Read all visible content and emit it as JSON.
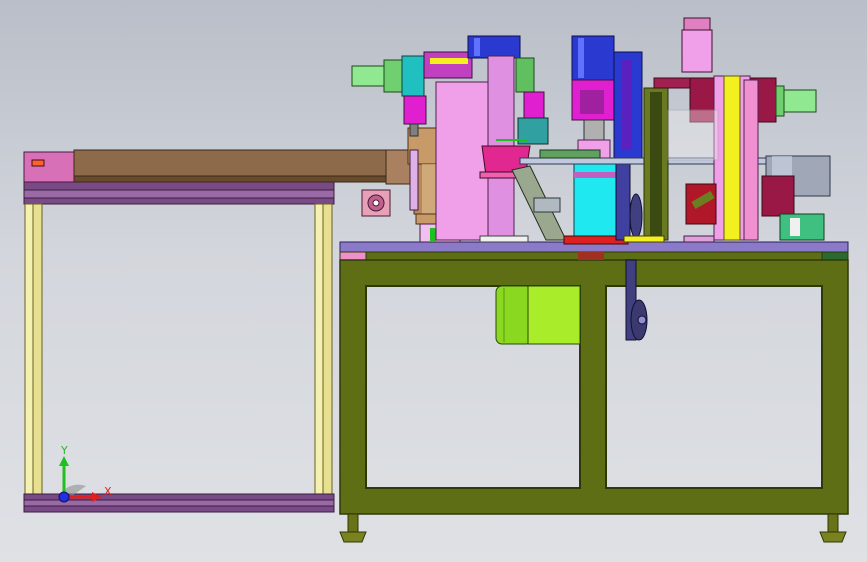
{
  "viewport": {
    "background_top": "#b9bec8",
    "background_bottom": "#dfe1e5"
  },
  "colors": {
    "frame_green": "#5d6e14",
    "frame_edge": "#2f3808",
    "conveyor_purple": "#7a4a86",
    "conveyor_belt": "#8c6a4a",
    "post_yellow": "#f4f0b0",
    "motor_lime": "#a8ec2a",
    "magenta": "#e040e0",
    "pink": "#f0a0e0",
    "cyan": "#20e8f0",
    "blue": "#2a3ad0",
    "yellow": "#f4f020",
    "maroon": "#9a1846",
    "bronze": "#c89a68",
    "light_green": "#90e890"
  },
  "triad": {
    "x_label": "X",
    "y_label": "Y",
    "x_color": "#e02020",
    "y_color": "#20c020",
    "z_color": "#2030e0"
  }
}
